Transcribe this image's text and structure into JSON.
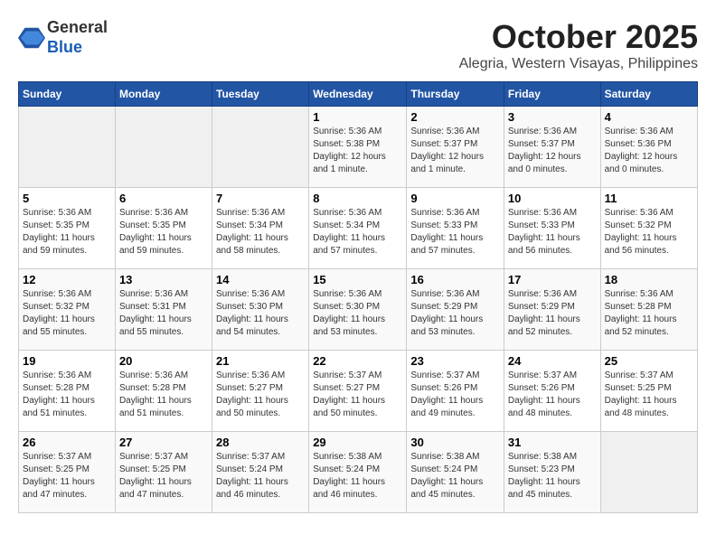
{
  "header": {
    "logo_line1": "General",
    "logo_line2": "Blue",
    "month": "October 2025",
    "location": "Alegria, Western Visayas, Philippines"
  },
  "days_of_week": [
    "Sunday",
    "Monday",
    "Tuesday",
    "Wednesday",
    "Thursday",
    "Friday",
    "Saturday"
  ],
  "weeks": [
    [
      {
        "day": "",
        "info": ""
      },
      {
        "day": "",
        "info": ""
      },
      {
        "day": "",
        "info": ""
      },
      {
        "day": "1",
        "info": "Sunrise: 5:36 AM\nSunset: 5:38 PM\nDaylight: 12 hours\nand 1 minute."
      },
      {
        "day": "2",
        "info": "Sunrise: 5:36 AM\nSunset: 5:37 PM\nDaylight: 12 hours\nand 1 minute."
      },
      {
        "day": "3",
        "info": "Sunrise: 5:36 AM\nSunset: 5:37 PM\nDaylight: 12 hours\nand 0 minutes."
      },
      {
        "day": "4",
        "info": "Sunrise: 5:36 AM\nSunset: 5:36 PM\nDaylight: 12 hours\nand 0 minutes."
      }
    ],
    [
      {
        "day": "5",
        "info": "Sunrise: 5:36 AM\nSunset: 5:35 PM\nDaylight: 11 hours\nand 59 minutes."
      },
      {
        "day": "6",
        "info": "Sunrise: 5:36 AM\nSunset: 5:35 PM\nDaylight: 11 hours\nand 59 minutes."
      },
      {
        "day": "7",
        "info": "Sunrise: 5:36 AM\nSunset: 5:34 PM\nDaylight: 11 hours\nand 58 minutes."
      },
      {
        "day": "8",
        "info": "Sunrise: 5:36 AM\nSunset: 5:34 PM\nDaylight: 11 hours\nand 57 minutes."
      },
      {
        "day": "9",
        "info": "Sunrise: 5:36 AM\nSunset: 5:33 PM\nDaylight: 11 hours\nand 57 minutes."
      },
      {
        "day": "10",
        "info": "Sunrise: 5:36 AM\nSunset: 5:33 PM\nDaylight: 11 hours\nand 56 minutes."
      },
      {
        "day": "11",
        "info": "Sunrise: 5:36 AM\nSunset: 5:32 PM\nDaylight: 11 hours\nand 56 minutes."
      }
    ],
    [
      {
        "day": "12",
        "info": "Sunrise: 5:36 AM\nSunset: 5:32 PM\nDaylight: 11 hours\nand 55 minutes."
      },
      {
        "day": "13",
        "info": "Sunrise: 5:36 AM\nSunset: 5:31 PM\nDaylight: 11 hours\nand 55 minutes."
      },
      {
        "day": "14",
        "info": "Sunrise: 5:36 AM\nSunset: 5:30 PM\nDaylight: 11 hours\nand 54 minutes."
      },
      {
        "day": "15",
        "info": "Sunrise: 5:36 AM\nSunset: 5:30 PM\nDaylight: 11 hours\nand 53 minutes."
      },
      {
        "day": "16",
        "info": "Sunrise: 5:36 AM\nSunset: 5:29 PM\nDaylight: 11 hours\nand 53 minutes."
      },
      {
        "day": "17",
        "info": "Sunrise: 5:36 AM\nSunset: 5:29 PM\nDaylight: 11 hours\nand 52 minutes."
      },
      {
        "day": "18",
        "info": "Sunrise: 5:36 AM\nSunset: 5:28 PM\nDaylight: 11 hours\nand 52 minutes."
      }
    ],
    [
      {
        "day": "19",
        "info": "Sunrise: 5:36 AM\nSunset: 5:28 PM\nDaylight: 11 hours\nand 51 minutes."
      },
      {
        "day": "20",
        "info": "Sunrise: 5:36 AM\nSunset: 5:28 PM\nDaylight: 11 hours\nand 51 minutes."
      },
      {
        "day": "21",
        "info": "Sunrise: 5:36 AM\nSunset: 5:27 PM\nDaylight: 11 hours\nand 50 minutes."
      },
      {
        "day": "22",
        "info": "Sunrise: 5:37 AM\nSunset: 5:27 PM\nDaylight: 11 hours\nand 50 minutes."
      },
      {
        "day": "23",
        "info": "Sunrise: 5:37 AM\nSunset: 5:26 PM\nDaylight: 11 hours\nand 49 minutes."
      },
      {
        "day": "24",
        "info": "Sunrise: 5:37 AM\nSunset: 5:26 PM\nDaylight: 11 hours\nand 48 minutes."
      },
      {
        "day": "25",
        "info": "Sunrise: 5:37 AM\nSunset: 5:25 PM\nDaylight: 11 hours\nand 48 minutes."
      }
    ],
    [
      {
        "day": "26",
        "info": "Sunrise: 5:37 AM\nSunset: 5:25 PM\nDaylight: 11 hours\nand 47 minutes."
      },
      {
        "day": "27",
        "info": "Sunrise: 5:37 AM\nSunset: 5:25 PM\nDaylight: 11 hours\nand 47 minutes."
      },
      {
        "day": "28",
        "info": "Sunrise: 5:37 AM\nSunset: 5:24 PM\nDaylight: 11 hours\nand 46 minutes."
      },
      {
        "day": "29",
        "info": "Sunrise: 5:38 AM\nSunset: 5:24 PM\nDaylight: 11 hours\nand 46 minutes."
      },
      {
        "day": "30",
        "info": "Sunrise: 5:38 AM\nSunset: 5:24 PM\nDaylight: 11 hours\nand 45 minutes."
      },
      {
        "day": "31",
        "info": "Sunrise: 5:38 AM\nSunset: 5:23 PM\nDaylight: 11 hours\nand 45 minutes."
      },
      {
        "day": "",
        "info": ""
      }
    ]
  ]
}
